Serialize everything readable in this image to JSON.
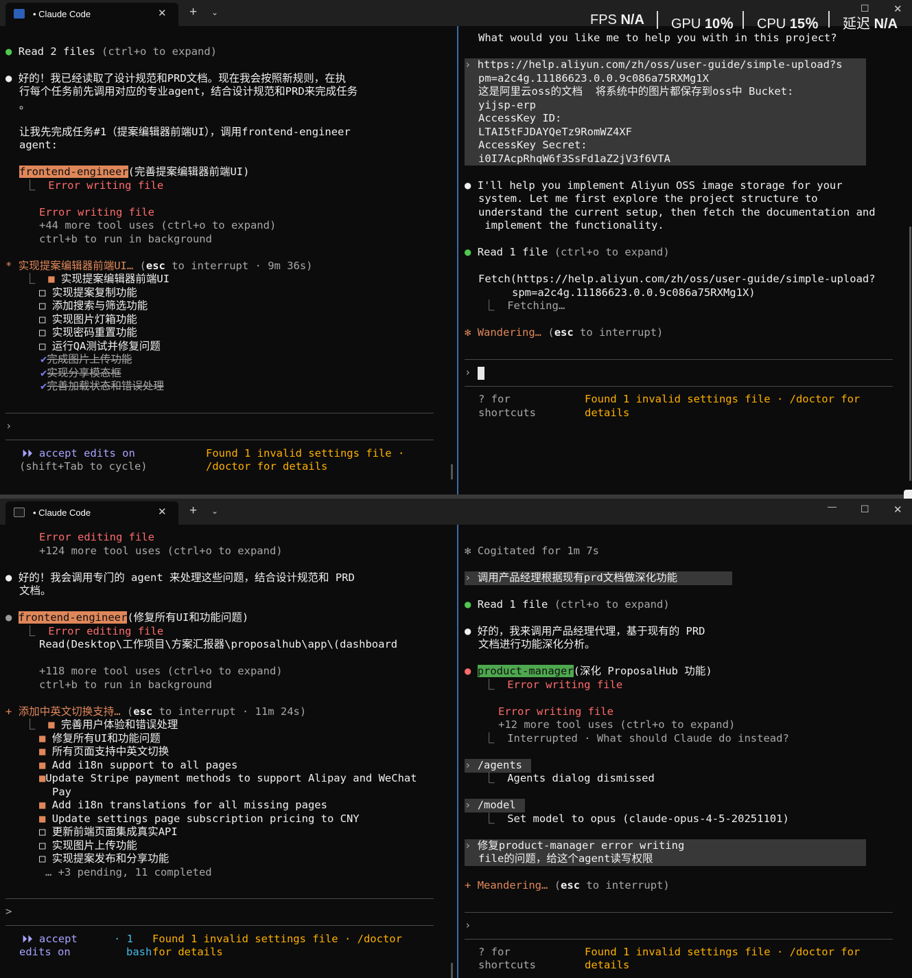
{
  "top": {
    "tab": {
      "title": "Claude Code",
      "close": "✕"
    },
    "tabbar": {
      "plus": "+",
      "dropdown": "⌄",
      "restore": "☐",
      "close": "✕"
    },
    "hud": {
      "fps_label": "FPS",
      "fps_value": "N/A",
      "gpu_label": "GPU",
      "gpu_value": "10％",
      "cpu_label": "CPU",
      "cpu_value": "15％",
      "latency_label": "延迟",
      "latency_value": "N/A"
    },
    "left": {
      "read_files": "Read",
      "read_count": "2 files",
      "read_hint": "(ctrl+o to expand)",
      "msg1_l1": "好的！我已经读取了设计规范和PRD文档。现在我会按照新规则，在执",
      "msg1_l2": "行每个任务前先调用对应的专业agent，结合设计规范和PRD来完成任务",
      "msg1_l3": "。",
      "msg2_l1": "让我先完成任务#1（提案编辑器前端UI），调用frontend-engineer",
      "msg2_l2": "agent:",
      "agent_name": "frontend-engineer",
      "agent_task": "(完善提案编辑器前端UI)",
      "err1": "Error writing file",
      "err2": "Error writing file",
      "more_uses": "+44 more tool uses (ctrl+o to expand)",
      "bg_hint": "ctrl+b to run in background",
      "status_title": "实现提案编辑器前端UI…",
      "status_esc": "esc",
      "status_rest": "to interrupt · 9m 36s)",
      "todos": [
        "实现提案编辑器前端UI",
        "实现提案复制功能",
        "添加搜索与筛选功能",
        "实现图片灯箱功能",
        "实现密码重置功能",
        "运行QA测试并修复问题"
      ],
      "done": [
        "完成图片上传功能",
        "实现分享模态框",
        "完善加载状态和错误处理"
      ],
      "prompt": "›",
      "mode_l1": "accept edits on",
      "mode_l2": "(shift+Tab to cycle)",
      "warn_l1": "Found 1 invalid settings file ·",
      "warn_l2": "/doctor for details"
    },
    "right": {
      "question": "What would you like me to help you with in this project?",
      "user_l1": "https://help.aliyun.com/zh/oss/user-guide/simple-upload?s",
      "user_l2": "pm=a2c4g.11186623.0.0.9c086a75RXMg1X",
      "user_l3": "这是阿里云oss的文档  将系统中的图片都保存到oss中 Bucket:",
      "user_l4": "yijsp-erp",
      "user_l5": "AccessKey ID:",
      "user_l6": "LTAI5tFJDAYQeTz9RomWZ4XF",
      "user_l7": "AccessKey Secret:",
      "user_l8": "i0I7AcpRhqW6f3SsFd1aZ2jV3f6VTA",
      "resp_l1": "I'll help you implement Aliyun OSS image storage for your",
      "resp_l2": "system. Let me first explore the project structure to",
      "resp_l3": "understand the current setup, then fetch the documentation and",
      "resp_l4": " implement the functionality.",
      "read_label": "Read",
      "read_count": "1 file",
      "read_hint": "(ctrl+o to expand)",
      "fetch_l1": "Fetch(https://help.aliyun.com/zh/oss/user-guide/simple-upload?",
      "fetch_l2": "spm=a2c4g.11186623.0.0.9c086a75RXMg1X)",
      "fetching": "Fetching…",
      "status_word": "Wandering…",
      "status_esc": "esc",
      "status_rest": "to interrupt)",
      "prompt": "›",
      "sc_l1": "? for",
      "sc_l2": "shortcuts",
      "warn_l1": "Found 1 invalid settings file · /doctor for",
      "warn_l2": "details"
    }
  },
  "bottom": {
    "tab": {
      "title": "Claude Code",
      "close": "✕"
    },
    "tabbar": {
      "plus": "+",
      "dropdown": "⌄",
      "minimize": "—",
      "maximize": "☐",
      "close": "✕"
    },
    "left": {
      "err_top": "Error editing file",
      "more_top": "+124 more tool uses (ctrl+o to expand)",
      "msg_l1": "好的！我会调用专门的 agent 来处理这些问题，结合设计规范和 PRD",
      "msg_l2": "文档。",
      "agent_name": "frontend-engineer",
      "agent_task": "(修复所有UI和功能问题)",
      "err": "Error editing file",
      "read_line": "Read(Desktop\\工作项目\\方案汇报器\\proposalhub\\app\\(dashboard",
      "more_uses": "+118 more tool uses (ctrl+o to expand)",
      "bg_hint": "ctrl+b to run in background",
      "status_title": "添加中英文切换支持…",
      "status_esc": "esc",
      "status_rest": "to interrupt · 11m 24s)",
      "t1": "完善用户体验和错误处理",
      "t2": "修复所有UI和功能问题",
      "t3": "所有页面支持中英文切换",
      "t4": "Add i18n support to all pages",
      "t5a": "Update Stripe payment methods to support Alipay and WeChat",
      "t5b": "Pay",
      "t6": "Add i18n translations for all missing pages",
      "t7": "Update settings page subscription pricing to CNY",
      "t8": "更新前端页面集成真实API",
      "t9": "实现图片上传功能",
      "t10": "实现提案发布和分享功能",
      "pending": "… +3 pending, 11 completed",
      "prompt": ">",
      "mode_l1": "accept",
      "mode_l2": "edits on",
      "bash_l1": "· 1",
      "bash_l2": "bash",
      "warn_l1": "Found 1 invalid settings file · /doctor",
      "warn_l2": "for details"
    },
    "right": {
      "cogitated": "Cogitated for 1m 7s",
      "user1": "调用产品经理根据现有prd文档做深化功能",
      "read_label": "Read",
      "read_count": "1 file",
      "read_hint": "(ctrl+o to expand)",
      "msg_l1": "好的，我来调用产品经理代理，基于现有的 PRD",
      "msg_l2": "文档进行功能深化分析。",
      "agent_name": "product-manager",
      "agent_task": "(深化 ProposalHub 功能)",
      "err1": "Error writing file",
      "err2": "Error writing file",
      "more_uses": "+12 more tool uses (ctrl+o to expand)",
      "interrupted": "Interrupted · What should Claude do instead?",
      "cmd_agents": "/agents",
      "agents_result": "Agents dialog dismissed",
      "cmd_model": "/model",
      "model_result": "Set model to opus (claude-opus-4-5-20251101)",
      "user2_l1": "修复product-manager error writing",
      "user2_l2": "file的问题，给这个agent读写权限",
      "status_word": "Meandering…",
      "status_esc": "esc",
      "status_rest": "to interrupt)",
      "prompt": "›",
      "sc_l1": "? for",
      "sc_l2": "shortcuts",
      "warn_l1": "Found 1 invalid settings file · /doctor for",
      "warn_l2": "details"
    }
  },
  "colors": {
    "background": "#0c0c0c",
    "error": "#ff6b6b",
    "agent_orange": "#e0875a",
    "agent_green": "#4ea84e",
    "warning": "#ffb000",
    "accept_mode": "#a8a3ff",
    "pane_divider": "#3a6ea5"
  }
}
